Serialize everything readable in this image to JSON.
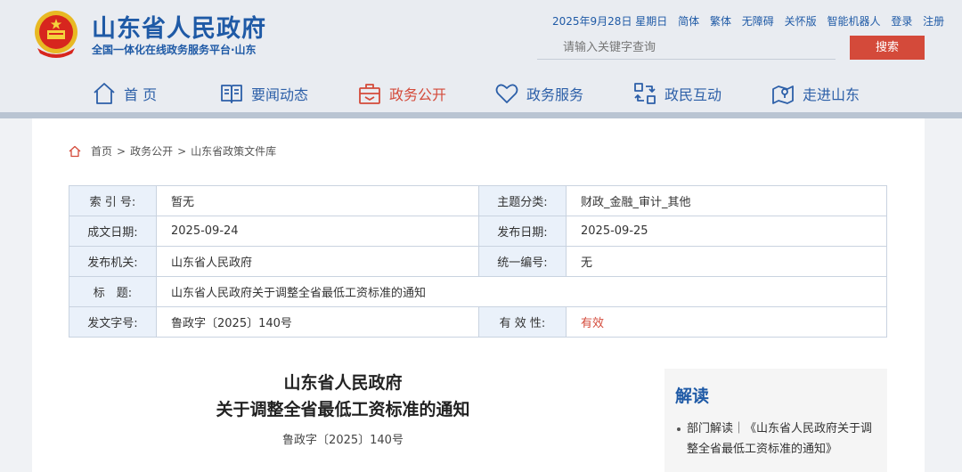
{
  "header": {
    "title": "山东省人民政府",
    "subtitle": "全国一体化在线政务服务平台·山东",
    "top_links": [
      "2025年9月28日 星期日",
      "简体",
      "繁体",
      "无障碍",
      "关怀版",
      "智能机器人",
      "登录",
      "注册"
    ],
    "search": {
      "placeholder": "请输入关键字查询",
      "button": "搜索"
    }
  },
  "nav": {
    "items": [
      {
        "label": "首 页",
        "icon": "home-icon"
      },
      {
        "label": "要闻动态",
        "icon": "book-icon"
      },
      {
        "label": "政务公开",
        "icon": "portfolio-icon",
        "active": true
      },
      {
        "label": "政务服务",
        "icon": "heart-icon"
      },
      {
        "label": "政民互动",
        "icon": "interaction-icon"
      },
      {
        "label": "走进山东",
        "icon": "map-pin-icon"
      }
    ]
  },
  "breadcrumb": {
    "items": [
      "首页",
      "政务公开",
      "山东省政策文件库"
    ],
    "separator": ">"
  },
  "meta_table": {
    "index_label": "索 引 号:",
    "index_value": "暂无",
    "topic_label": "主题分类:",
    "topic_value": "财政_金融_审计_其他",
    "written_label": "成文日期:",
    "written_value": "2025-09-24",
    "published_label": "发布日期:",
    "published_value": "2025-09-25",
    "issuer_label": "发布机关:",
    "issuer_value": "山东省人民政府",
    "serial_label": "统一编号:",
    "serial_value": "无",
    "title_label": "标　题:",
    "title_value": "山东省人民政府关于调整全省最低工资标准的通知",
    "docno_label": "发文字号:",
    "docno_value": "鲁政字〔2025〕140号",
    "validity_label": "有 效 性:",
    "validity_value": "有效",
    "validity_color": "#d44a3a"
  },
  "document": {
    "title_line1": "山东省人民政府",
    "title_line2": "关于调整全省最低工资标准的通知",
    "doc_number": "鲁政字〔2025〕140号"
  },
  "sidebar": {
    "title": "解读",
    "item": "部门解读｜《山东省人民政府关于调整全省最低工资标准的通知》"
  },
  "colors": {
    "brand_blue": "#1f5aa6",
    "accent_red": "#d44a3a"
  }
}
